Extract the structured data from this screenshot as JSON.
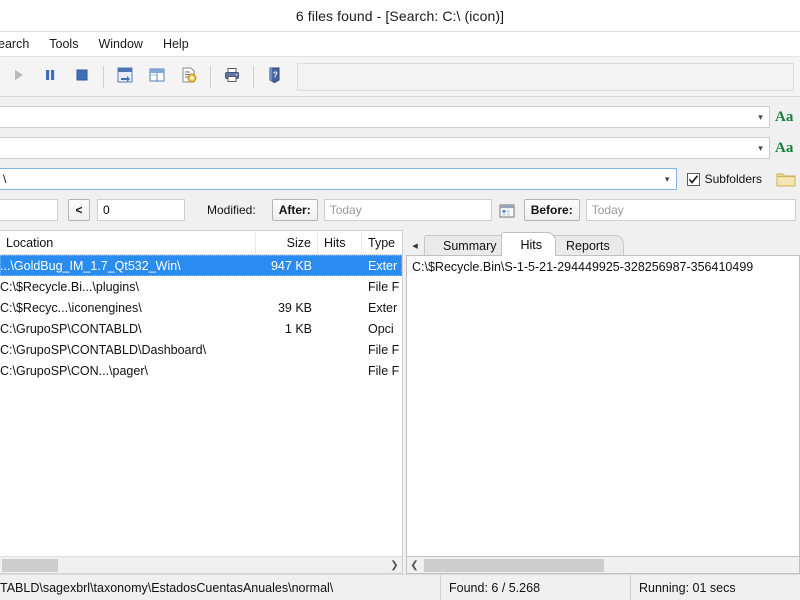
{
  "window": {
    "title": "6 files found - [Search: C:\\ (icon)]"
  },
  "menu": {
    "items": [
      {
        "label": "earch",
        "name": "menu-search"
      },
      {
        "label": "Tools",
        "name": "menu-tools"
      },
      {
        "label": "Window",
        "name": "menu-window"
      },
      {
        "label": "Help",
        "name": "menu-help"
      }
    ]
  },
  "toolbar": {
    "buttons": [
      {
        "icon": "play-icon",
        "label": "Start"
      },
      {
        "icon": "pause-icon",
        "label": "Pause"
      },
      {
        "icon": "stop-icon",
        "label": "Stop"
      },
      {
        "icon": "new-search-icon",
        "label": "New Search"
      },
      {
        "icon": "layout-icon",
        "label": "Layout"
      },
      {
        "icon": "search-options-icon",
        "label": "Search Options"
      },
      {
        "icon": "print-icon",
        "label": "Print"
      },
      {
        "icon": "help-icon",
        "label": "Help"
      }
    ]
  },
  "search": {
    "filename": {
      "value": "",
      "placeholder": ""
    },
    "containing_text": {
      "value": "",
      "placeholder": ""
    },
    "look_in": {
      "value": "\\",
      "placeholder": ""
    },
    "case_button_1": "Aa",
    "case_button_2": "Aa",
    "subfolders_label": "Subfolders",
    "subfolders_checked": true,
    "browse_icon": "folder-icon",
    "size_value": "",
    "size_operator": "<",
    "size_number": "0",
    "modified_label": "Modified:",
    "after_label": "After:",
    "after_value": "",
    "after_placeholder": "Today",
    "before_label": "Before:",
    "before_value": "",
    "before_placeholder": "Today",
    "calendar_icon": "calendar-icon"
  },
  "results": {
    "columns": [
      {
        "label": "Location",
        "key": "location"
      },
      {
        "label": "Size",
        "key": "size"
      },
      {
        "label": "Hits",
        "key": "hits"
      },
      {
        "label": "Type",
        "key": "type"
      }
    ],
    "rows": [
      {
        "location": "...\\GoldBug_IM_1.7_Qt532_Win\\",
        "size": "947 KB",
        "hits": "",
        "type": "Exter",
        "selected": true
      },
      {
        "location": "C:\\$Recycle.Bi...\\plugins\\",
        "size": "",
        "hits": "",
        "type": "File F",
        "selected": false
      },
      {
        "location": "C:\\$Recyc...\\iconengines\\",
        "size": "39 KB",
        "hits": "",
        "type": "Exter",
        "selected": false
      },
      {
        "location": "C:\\GrupoSP\\CONTABLD\\",
        "size": "1 KB",
        "hits": "",
        "type": "Opci",
        "selected": false
      },
      {
        "location": "C:\\GrupoSP\\CONTABLD\\Dashboard\\",
        "size": "",
        "hits": "",
        "type": "File F",
        "selected": false
      },
      {
        "location": "C:\\GrupoSP\\CON...\\pager\\",
        "size": "",
        "hits": "",
        "type": "File F",
        "selected": false
      }
    ]
  },
  "detail": {
    "tabs": [
      {
        "label": "Summary",
        "active": false
      },
      {
        "label": "Hits",
        "active": true
      },
      {
        "label": "Reports",
        "active": false
      }
    ],
    "hits_content": "C:\\$Recycle.Bin\\S-1-5-21-294449925-328256987-356410499"
  },
  "statusbar": {
    "path": "TABLD\\sagexbrl\\taxonomy\\EstadosCuentasAnuales\\normal\\",
    "found": "Found: 6 / 5.268",
    "running": "Running: 01 secs"
  },
  "colors": {
    "selection": "#2a8cf0",
    "accent_green": "#15803d",
    "folder_yellow": "#e8d37a",
    "chrome": "#f0f0f0"
  }
}
